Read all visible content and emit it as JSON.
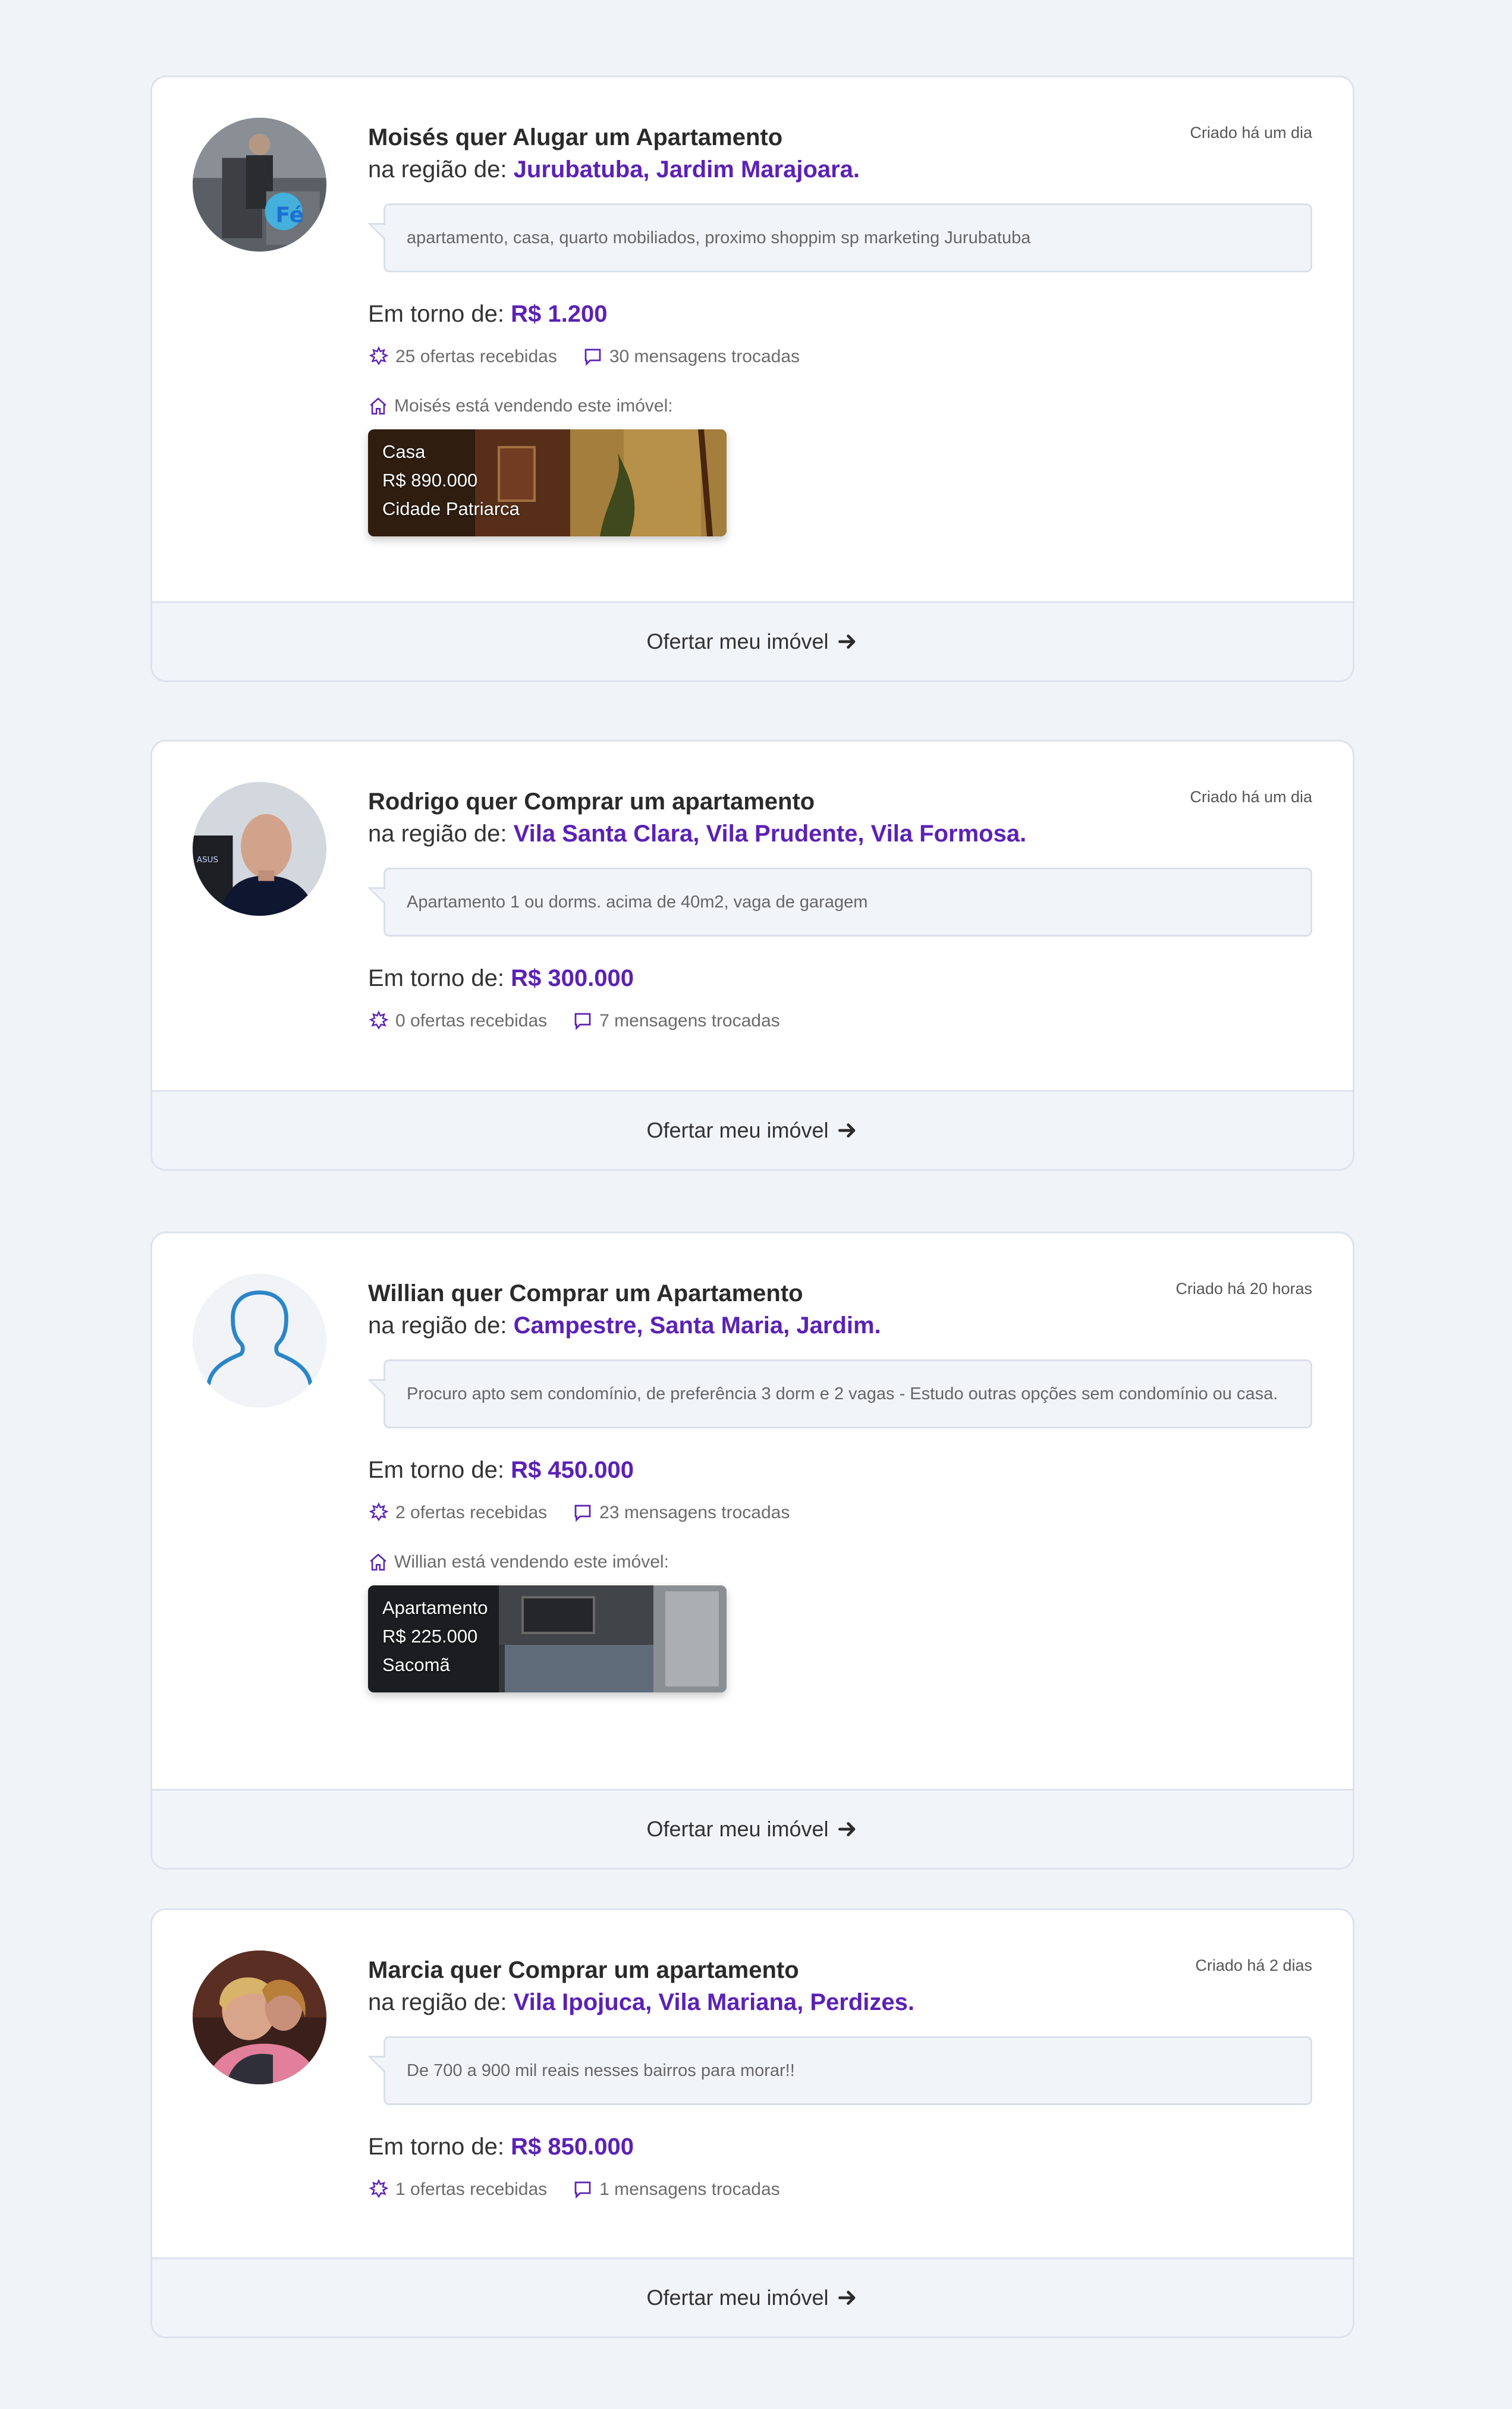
{
  "cards": [
    {
      "title": "Moisés quer Alugar um Apartamento",
      "region_prefix": "na região de:",
      "region_places": "Jurubatuba, Jardim Marajoara.",
      "created": "Criado há um dia",
      "description": "apartamento, casa, quarto mobiliados, proximo shoppim sp marketing Jurubatuba",
      "price_prefix": "Em torno de:",
      "price": "R$ 1.200",
      "offers": "25 ofertas recebidas",
      "messages": "30 mensagens trocadas",
      "selling_text": "Moisés está vendendo este imóvel:",
      "listing": {
        "type": "Casa",
        "price": "R$ 890.000",
        "location": "Cidade Patriarca"
      },
      "cta": "Ofertar meu imóvel"
    },
    {
      "title": "Rodrigo quer Comprar um apartamento",
      "region_prefix": "na região de:",
      "region_places": "Vila Santa Clara, Vila Prudente, Vila Formosa.",
      "created": "Criado há um dia",
      "description": "Apartamento 1 ou dorms. acima de 40m2, vaga de garagem",
      "price_prefix": "Em torno de:",
      "price": "R$ 300.000",
      "offers": "0 ofertas recebidas",
      "messages": "7 mensagens trocadas",
      "cta": "Ofertar meu imóvel"
    },
    {
      "title": "Willian quer Comprar um Apartamento",
      "region_prefix": "na região de:",
      "region_places": "Campestre, Santa Maria, Jardim.",
      "created": "Criado há 20 horas",
      "description": "Procuro apto sem condomínio, de preferência 3 dorm e 2 vagas - Estudo outras opções sem condomínio ou casa.",
      "price_prefix": "Em torno de:",
      "price": "R$ 450.000",
      "offers": "2 ofertas recebidas",
      "messages": "23 mensagens trocadas",
      "selling_text": "Willian está vendendo este imóvel:",
      "listing": {
        "type": "Apartamento",
        "price": "R$ 225.000",
        "location": "Sacomã"
      },
      "cta": "Ofertar meu imóvel"
    },
    {
      "title": "Marcia quer Comprar um apartamento",
      "region_prefix": "na região de:",
      "region_places": "Vila Ipojuca, Vila Mariana, Perdizes.",
      "created": "Criado há 2 dias",
      "description": "De 700 a 900 mil reais nesses bairros para morar!!",
      "price_prefix": "Em torno de:",
      "price": "R$ 850.000",
      "offers": "1 ofertas recebidas",
      "messages": "1 mensagens trocadas",
      "cta": "Ofertar meu imóvel"
    }
  ],
  "colors": {
    "accent": "#5b21b6",
    "background": "#f0f3f8",
    "card_border": "#dde3ee"
  },
  "icons": {
    "offers": "sparkle-icon",
    "messages": "chat-bubble-icon",
    "selling": "house-icon",
    "cta": "arrow-right-icon"
  }
}
